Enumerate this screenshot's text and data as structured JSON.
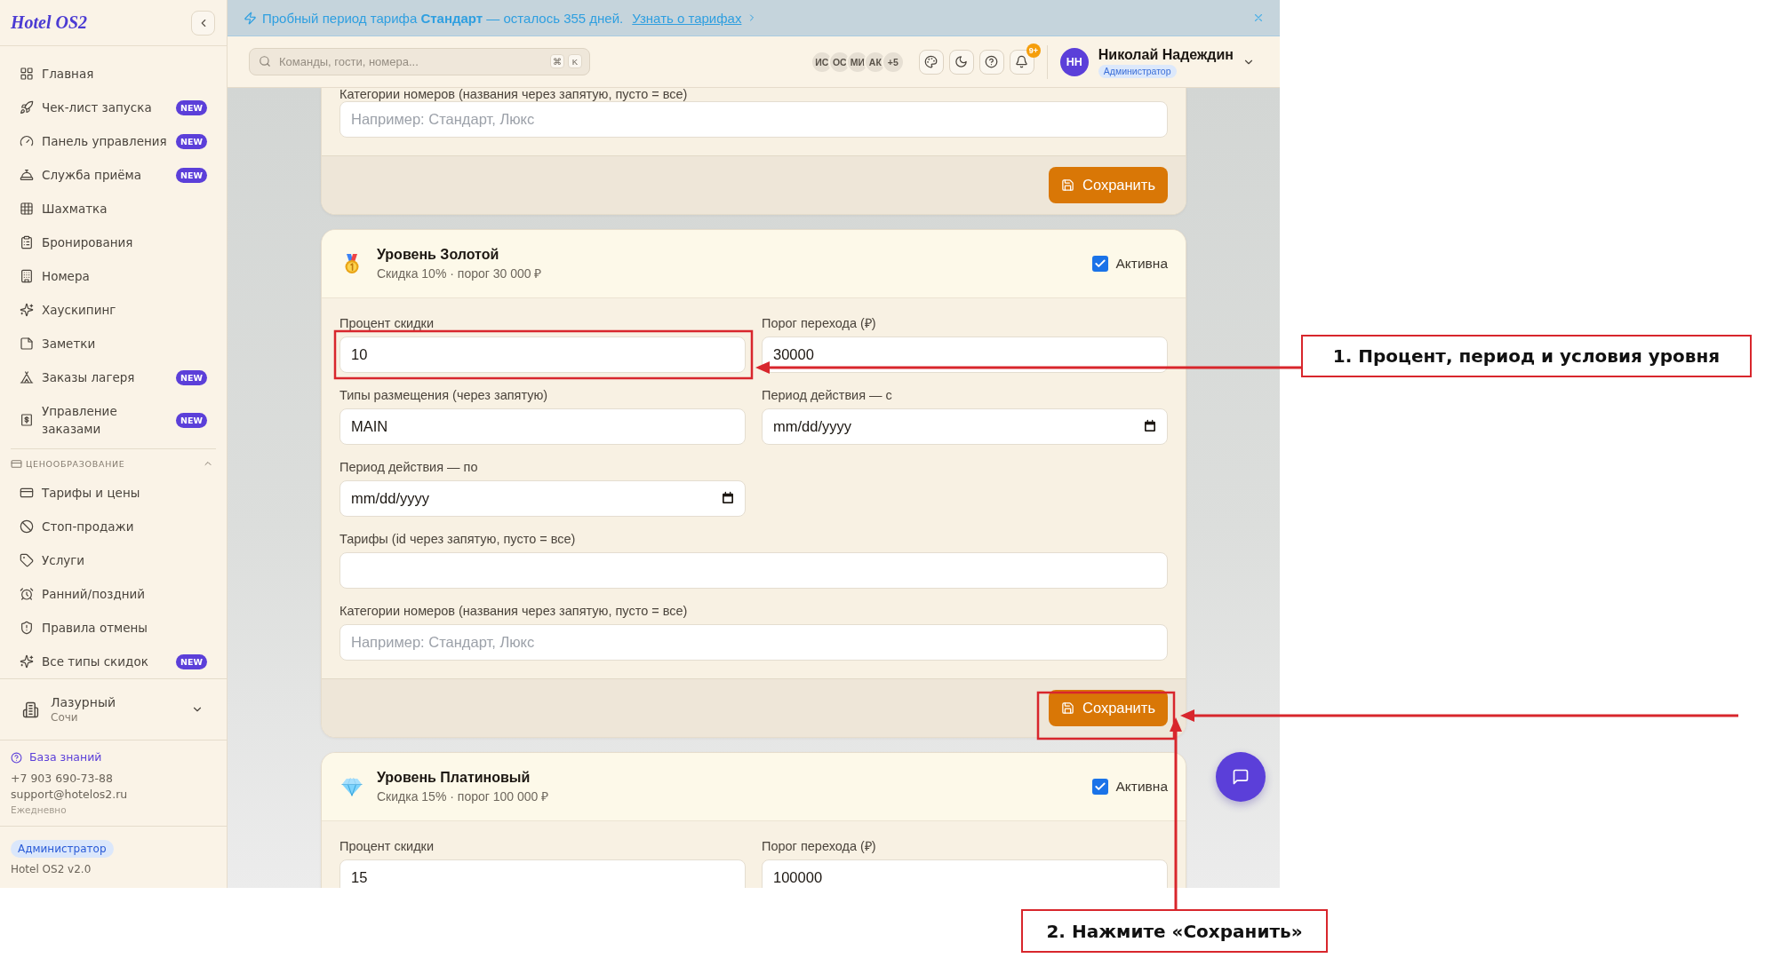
{
  "sidebar": {
    "logo": "Hotel OS2",
    "sections": [
      {
        "items": [
          {
            "label": "Главная",
            "selected": false
          },
          {
            "label": "Чек-лист запуска",
            "badge": "NEW",
            "selected": false
          },
          {
            "label": "Панель управления",
            "badge": "NEW",
            "selected": false
          },
          {
            "label": "Служба приёма",
            "badge": "NEW",
            "selected": false
          },
          {
            "label": "Шахматка",
            "selected": false
          },
          {
            "label": "Бронирования",
            "selected": false
          },
          {
            "label": "Номера",
            "selected": false
          },
          {
            "label": "Хаускипинг",
            "selected": false
          },
          {
            "label": "Заметки",
            "selected": false
          },
          {
            "label": "Заказы лагеря",
            "badge": "NEW",
            "selected": false
          },
          {
            "label": "Управление заказами",
            "badge": "NEW",
            "selected": false
          }
        ]
      },
      {
        "title": "ЦЕНООБРАЗОВАНИЕ",
        "expanded": true,
        "items": [
          {
            "label": "Тарифы и цены",
            "selected": false
          },
          {
            "label": "Стоп-продажи",
            "selected": false
          },
          {
            "label": "Услуги",
            "selected": false
          },
          {
            "label": "Ранний/поздний",
            "selected": false
          },
          {
            "label": "Правила отмены",
            "selected": false
          },
          {
            "label": "Все типы скидок",
            "badge": "NEW",
            "selected": false
          }
        ]
      }
    ],
    "hotel": {
      "name": "Лазурный",
      "city": "Сочи"
    },
    "support": {
      "link": "База знаний",
      "phone": "+7 903 690-73-88",
      "email": "support@hotelos2.ru",
      "hours": "Ежедневно"
    },
    "footer": {
      "role": "Администратор",
      "version": "Hotel OS2 v2.0"
    }
  },
  "banner": {
    "text": "Пробный период тарифа **Стандарт** — осталось 355 дней.",
    "link": "Узнать о тарифах"
  },
  "topbar": {
    "search": {
      "placeholder": "Команды, гости, номера...",
      "keys": [
        "⌘",
        "K"
      ]
    },
    "online_users": [
      "ИС",
      "ОС",
      "МИ",
      "АК"
    ],
    "online_more": "+5",
    "notifications_badge": "9+",
    "user": {
      "initials": "НН",
      "name": "Николай Надеждин",
      "role": "Администратор"
    }
  },
  "tiers": [
    {
      "rows": [
        [
          {
            "label": "Категории номеров (названия через запятую, пусто = все)",
            "kind": "text",
            "placeholder": "Например: Стандарт, Люкс"
          }
        ]
      ],
      "save_button": "Сохранить"
    },
    {
      "title": "Уровень Золотой",
      "subtitle": "Скидка 10% · порог 30 000 ₽",
      "active": true,
      "active_label": "Активна",
      "rows": [
        [
          {
            "label": "Процент скидки",
            "kind": "text",
            "value": "10"
          },
          {
            "label": "Порог перехода (₽)",
            "kind": "text",
            "value": "30000"
          }
        ],
        [
          {
            "label": "Типы размещения (через запятую)",
            "kind": "text",
            "value": "MAIN"
          },
          {
            "label": "Период действия — с",
            "kind": "date",
            "placeholder": "mm/dd/yyyy"
          }
        ],
        [
          {
            "label": "Период действия — по",
            "kind": "date",
            "placeholder": "mm/dd/yyyy"
          }
        ],
        [
          {
            "label": "Тарифы (id через запятую, пусто = все)",
            "kind": "text"
          }
        ],
        [
          {
            "label": "Категории номеров (названия через запятую, пусто = все)",
            "kind": "text",
            "placeholder": "Например: Стандарт, Люкс"
          }
        ]
      ],
      "save_button": "Сохранить"
    },
    {
      "title": "Уровень Платиновый",
      "subtitle": "Скидка 15% · порог 100 000 ₽",
      "active": true,
      "active_label": "Активна",
      "rows": [
        [
          {
            "label": "Процент скидки",
            "kind": "text",
            "value": "15"
          },
          {
            "label": "Порог перехода (₽)",
            "kind": "text",
            "value": "100000"
          }
        ]
      ]
    }
  ],
  "annotations": [
    {
      "text": "1. Процент, период и условия уровня"
    },
    {
      "text": "2. Нажмите «Сохранить»"
    }
  ]
}
